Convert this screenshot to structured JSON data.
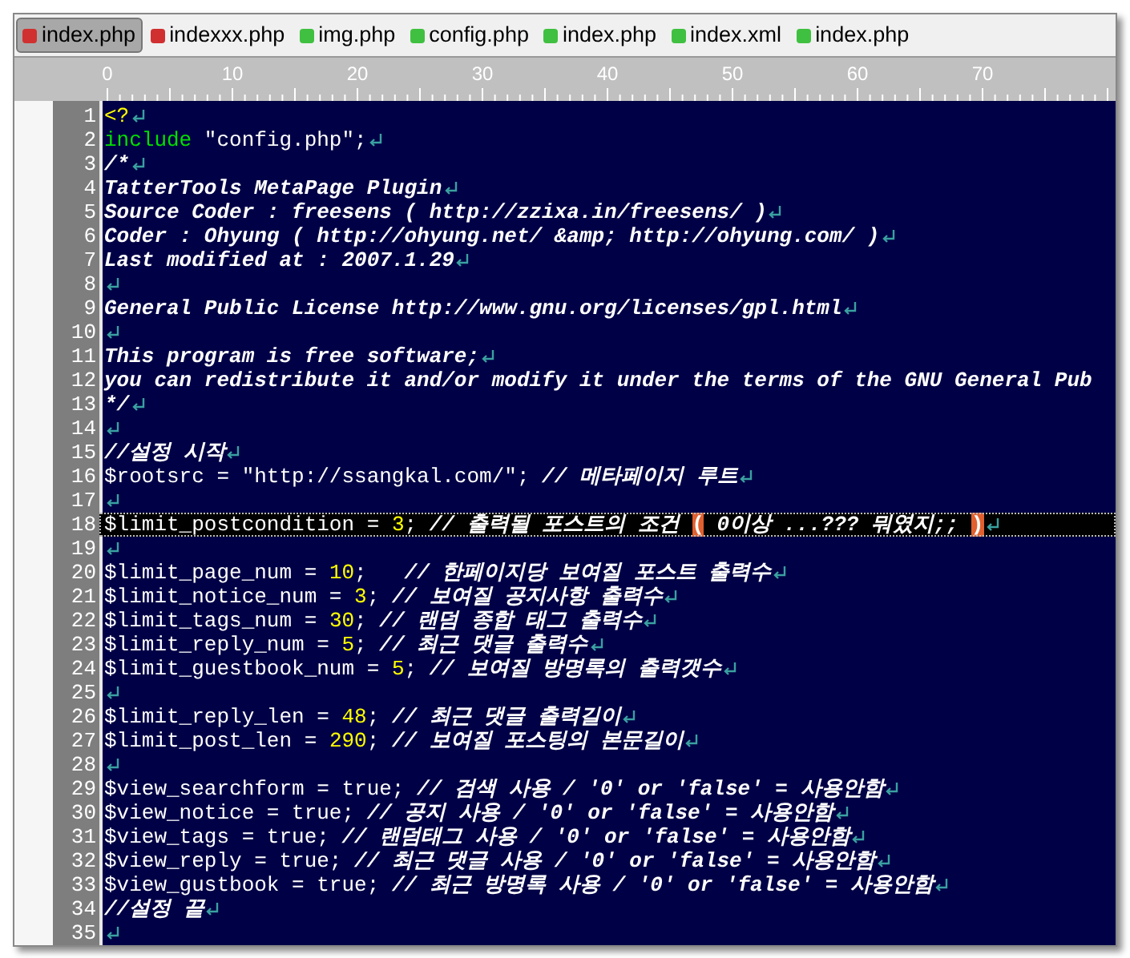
{
  "tabs": [
    {
      "label": "index.php",
      "selected": true,
      "color": "#d03030"
    },
    {
      "label": "indexxx.php",
      "selected": false,
      "color": "#d03030"
    },
    {
      "label": "img.php",
      "selected": false,
      "color": "#40c040"
    },
    {
      "label": "config.php",
      "selected": false,
      "color": "#40c040"
    },
    {
      "label": "index.php",
      "selected": false,
      "color": "#40c040"
    },
    {
      "label": "index.xml",
      "selected": false,
      "color": "#40c040"
    },
    {
      "label": "index.php",
      "selected": false,
      "color": "#40c040"
    }
  ],
  "ruler": [
    "0",
    "10",
    "20",
    "30",
    "40",
    "50",
    "60",
    "70"
  ],
  "lines": [
    {
      "number": "1",
      "current": false,
      "eol": true,
      "tokens": [
        {
          "kind": "tag",
          "text": "<?"
        }
      ]
    },
    {
      "number": "2",
      "current": false,
      "eol": true,
      "tokens": [
        {
          "kind": "keyword",
          "text": "include"
        },
        {
          "kind": "plain",
          "text": " \"config.php\";"
        }
      ]
    },
    {
      "number": "3",
      "current": false,
      "eol": true,
      "tokens": [
        {
          "kind": "comment",
          "text": "/*"
        }
      ]
    },
    {
      "number": "4",
      "current": false,
      "eol": true,
      "tokens": [
        {
          "kind": "comment",
          "text": "TatterTools MetaPage Plugin"
        }
      ]
    },
    {
      "number": "5",
      "current": false,
      "eol": true,
      "tokens": [
        {
          "kind": "comment",
          "text": "Source Coder : freesens ( http://zzixa.in/freesens/ )"
        }
      ]
    },
    {
      "number": "6",
      "current": false,
      "eol": true,
      "tokens": [
        {
          "kind": "comment",
          "text": "Coder : Ohyung ( http://ohyung.net/ &amp; http://ohyung.com/ )"
        }
      ]
    },
    {
      "number": "7",
      "current": false,
      "eol": true,
      "tokens": [
        {
          "kind": "comment",
          "text": "Last modified at : 2007.1.29"
        }
      ]
    },
    {
      "number": "8",
      "current": false,
      "eol": true
    },
    {
      "number": "9",
      "current": false,
      "eol": true,
      "tokens": [
        {
          "kind": "comment",
          "text": "General Public License http://www.gnu.org/licenses/gpl.html"
        }
      ]
    },
    {
      "number": "10",
      "current": false,
      "eol": true
    },
    {
      "number": "11",
      "current": false,
      "eol": true,
      "tokens": [
        {
          "kind": "comment",
          "text": "This program is free software;"
        }
      ]
    },
    {
      "number": "12",
      "current": false,
      "eol": false,
      "tokens": [
        {
          "kind": "comment",
          "text": "you can redistribute it and/or modify it under the terms of the GNU General Pub"
        }
      ]
    },
    {
      "number": "13",
      "current": false,
      "eol": true,
      "tokens": [
        {
          "kind": "comment",
          "text": "*/"
        }
      ]
    },
    {
      "number": "14",
      "current": false,
      "eol": true
    },
    {
      "number": "15",
      "current": false,
      "eol": true,
      "tokens": [
        {
          "kind": "comment",
          "text": "//설정 시작"
        }
      ]
    },
    {
      "number": "16",
      "current": false,
      "eol": true,
      "tokens": [
        {
          "kind": "plain",
          "text": "$rootsrc = \"http://ssangkal.com/\"; "
        },
        {
          "kind": "comment",
          "text": "// 메타페이지 루트"
        }
      ]
    },
    {
      "number": "17",
      "current": false,
      "eol": true
    },
    {
      "number": "18",
      "current": true,
      "eol": true,
      "tokens": [
        {
          "kind": "plain",
          "text": "$limit_postcondition = "
        },
        {
          "kind": "number",
          "text": "3"
        },
        {
          "kind": "plain",
          "text": "; "
        },
        {
          "kind": "comment",
          "text": "// 출력될 포스트의 조건 "
        },
        {
          "kind": "bracket",
          "text": "("
        },
        {
          "kind": "comment",
          "text": " 0이상 ...??? 뭐였지;; "
        },
        {
          "kind": "bracket",
          "text": ")"
        }
      ]
    },
    {
      "number": "19",
      "current": false,
      "eol": true
    },
    {
      "number": "20",
      "current": false,
      "eol": true,
      "tokens": [
        {
          "kind": "plain",
          "text": "$limit_page_num = "
        },
        {
          "kind": "number",
          "text": "10"
        },
        {
          "kind": "plain",
          "text": ";   "
        },
        {
          "kind": "comment",
          "text": "// 한페이지당 보여질 포스트 출력수"
        }
      ]
    },
    {
      "number": "21",
      "current": false,
      "eol": true,
      "tokens": [
        {
          "kind": "plain",
          "text": "$limit_notice_num = "
        },
        {
          "kind": "number",
          "text": "3"
        },
        {
          "kind": "plain",
          "text": "; "
        },
        {
          "kind": "comment",
          "text": "// 보여질 공지사항 출력수"
        }
      ]
    },
    {
      "number": "22",
      "current": false,
      "eol": true,
      "tokens": [
        {
          "kind": "plain",
          "text": "$limit_tags_num = "
        },
        {
          "kind": "number",
          "text": "30"
        },
        {
          "kind": "plain",
          "text": "; "
        },
        {
          "kind": "comment",
          "text": "// 랜덤 종합 태그 출력수"
        }
      ]
    },
    {
      "number": "23",
      "current": false,
      "eol": true,
      "tokens": [
        {
          "kind": "plain",
          "text": "$limit_reply_num = "
        },
        {
          "kind": "number",
          "text": "5"
        },
        {
          "kind": "plain",
          "text": "; "
        },
        {
          "kind": "comment",
          "text": "// 최근 댓글 출력수"
        }
      ]
    },
    {
      "number": "24",
      "current": false,
      "eol": true,
      "tokens": [
        {
          "kind": "plain",
          "text": "$limit_guestbook_num = "
        },
        {
          "kind": "number",
          "text": "5"
        },
        {
          "kind": "plain",
          "text": "; "
        },
        {
          "kind": "comment",
          "text": "// 보여질 방명록의 출력갯수"
        }
      ]
    },
    {
      "number": "25",
      "current": false,
      "eol": true
    },
    {
      "number": "26",
      "current": false,
      "eol": true,
      "tokens": [
        {
          "kind": "plain",
          "text": "$limit_reply_len = "
        },
        {
          "kind": "number",
          "text": "48"
        },
        {
          "kind": "plain",
          "text": "; "
        },
        {
          "kind": "comment",
          "text": "// 최근 댓글 출력길이"
        }
      ]
    },
    {
      "number": "27",
      "current": false,
      "eol": true,
      "tokens": [
        {
          "kind": "plain",
          "text": "$limit_post_len = "
        },
        {
          "kind": "number",
          "text": "290"
        },
        {
          "kind": "plain",
          "text": "; "
        },
        {
          "kind": "comment",
          "text": "// 보여질 포스팅의 본문길이"
        }
      ]
    },
    {
      "number": "28",
      "current": false,
      "eol": true
    },
    {
      "number": "29",
      "current": false,
      "eol": true,
      "tokens": [
        {
          "kind": "plain",
          "text": "$view_searchform = true; "
        },
        {
          "kind": "comment",
          "text": "// 검색 사용 / '0' or 'false' = 사용안함"
        }
      ]
    },
    {
      "number": "30",
      "current": false,
      "eol": true,
      "tokens": [
        {
          "kind": "plain",
          "text": "$view_notice = true; "
        },
        {
          "kind": "comment",
          "text": "// 공지 사용 / '0' or 'false' = 사용안함"
        }
      ]
    },
    {
      "number": "31",
      "current": false,
      "eol": true,
      "tokens": [
        {
          "kind": "plain",
          "text": "$view_tags = true; "
        },
        {
          "kind": "comment",
          "text": "// 랜덤태그 사용 / '0' or 'false' = 사용안함"
        }
      ]
    },
    {
      "number": "32",
      "current": false,
      "eol": true,
      "tokens": [
        {
          "kind": "plain",
          "text": "$view_reply = true; "
        },
        {
          "kind": "comment",
          "text": "// 최근 댓글 사용 / '0' or 'false' = 사용안함"
        }
      ]
    },
    {
      "number": "33",
      "current": false,
      "eol": true,
      "tokens": [
        {
          "kind": "plain",
          "text": "$view_gustbook = true; "
        },
        {
          "kind": "comment",
          "text": "// 최근 방명록 사용 / '0' or 'false' = 사용안함"
        }
      ]
    },
    {
      "number": "34",
      "current": false,
      "eol": true,
      "tokens": [
        {
          "kind": "comment",
          "text": "//설정 끝"
        }
      ]
    },
    {
      "number": "35",
      "current": false,
      "eol": true
    }
  ]
}
